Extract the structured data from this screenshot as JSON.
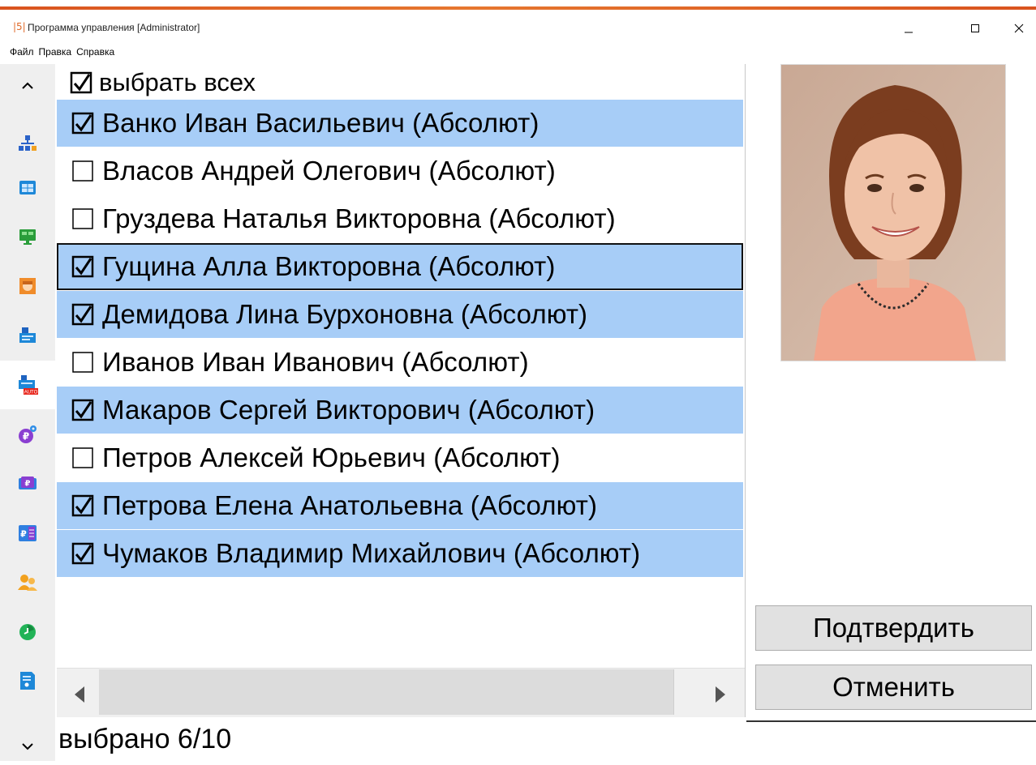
{
  "window": {
    "app_icon": "|5|",
    "title": "Программа управления [Administrator]"
  },
  "menu": [
    "Файл",
    "Правка",
    "Справка"
  ],
  "sidebar": {
    "icons": [
      "org-structure-icon",
      "calendar-icon",
      "monitor-icon",
      "face-id-icon",
      "printer-icon",
      "printer-auto-icon",
      "ruble-settings-icon",
      "ruble-card-icon",
      "ruble-document-icon",
      "users-icon",
      "clock-chart-icon",
      "report-icon"
    ],
    "auto_badge": "AUTO",
    "ruble_glyph": "₽"
  },
  "list": {
    "select_all_label": "выбрать всех",
    "select_all_checked": true,
    "people": [
      {
        "name": "Ванко Иван Васильевич (Абсолют)",
        "checked": true
      },
      {
        "name": "Власов Андрей Олегович (Абсолют)",
        "checked": false
      },
      {
        "name": "Груздева Наталья Викторовна (Абсолют)",
        "checked": false
      },
      {
        "name": "Гущина Алла Викторовна (Абсолют)",
        "checked": true,
        "focused": true
      },
      {
        "name": "Демидова Лина Бурхоновна (Абсолют)",
        "checked": true
      },
      {
        "name": "Иванов Иван Иванович (Абсолют)",
        "checked": false
      },
      {
        "name": "Макаров Сергей Викторович (Абсолют)",
        "checked": true
      },
      {
        "name": "Петров Алексей Юрьевич (Абсолют)",
        "checked": false
      },
      {
        "name": "Петрова Елена Анатольевна (Абсолют)",
        "checked": true
      },
      {
        "name": "Чумаков Владимир Михайлович (Абсолют)",
        "checked": true
      }
    ]
  },
  "buttons": {
    "confirm": "Подтвердить",
    "cancel": "Отменить"
  },
  "status": "выбрано 6/10",
  "colors": {
    "selected_row": "#a7cdf7",
    "accent": "#e06a2a"
  }
}
